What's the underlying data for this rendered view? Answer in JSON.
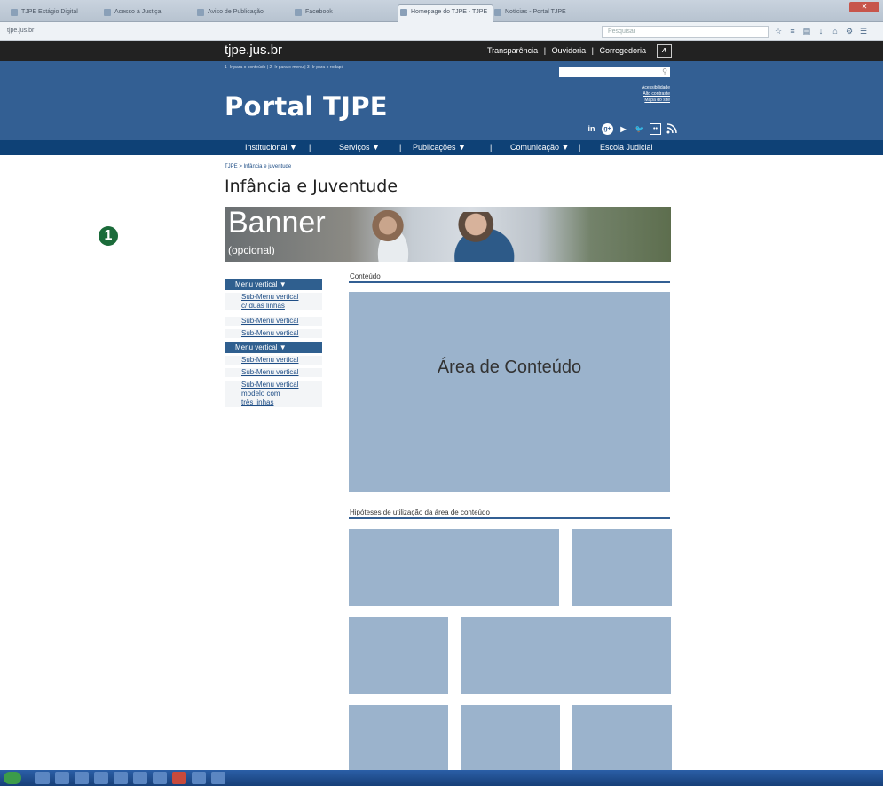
{
  "browser": {
    "tabs": [
      {
        "label": "TJPE Estágio Digital"
      },
      {
        "label": "Acesso à Justiça"
      },
      {
        "label": "Aviso de Publicação"
      },
      {
        "label": "Facebook"
      },
      {
        "label": "Homepage do TJPE - TJPE"
      },
      {
        "label": "Notícias - Portal TJPE"
      }
    ],
    "url": "tjpe.jus.br",
    "search_placeholder": "Pesquisar",
    "window_control": "✕"
  },
  "site": {
    "domain": "tjpe.jus.br",
    "top_links": [
      "Transparência",
      "Ouvidoria",
      "Corregedoria"
    ],
    "contrast_button": "A",
    "skip_links": "1- Ir para o conteúdo  |  2- Ir para o menu  |  3- Ir para o rodapé",
    "search_icon": "⚲",
    "access_links": [
      "Acessibilidade",
      "Alto contraste",
      "Mapa do site"
    ],
    "portal_title": "Portal TJPE",
    "social": [
      {
        "icon": "linkedin-icon",
        "glyph": "in"
      },
      {
        "icon": "google-plus-icon",
        "glyph": "g+"
      },
      {
        "icon": "youtube-icon",
        "glyph": "▶"
      },
      {
        "icon": "twitter-icon",
        "glyph": "🐦"
      },
      {
        "icon": "flickr-icon",
        "glyph": "••"
      },
      {
        "icon": "rss-icon",
        "glyph": "☰"
      }
    ],
    "nav": [
      {
        "label": "Institucional ▼"
      },
      {
        "label": "Serviços ▼"
      },
      {
        "label": "Publicações ▼"
      },
      {
        "label": "Comunicação ▼"
      },
      {
        "label": "Escola Judicial"
      }
    ],
    "nav_separator": "|"
  },
  "page": {
    "breadcrumb": "TJPE > Infância e juventude",
    "title": "Infância e Juventude",
    "banner": {
      "text": "Banner",
      "subtext": "(opcional)"
    },
    "annotation_badge": "1",
    "sidebar": {
      "groups": [
        {
          "head": "Menu vertical  ▼",
          "items": [
            {
              "lines": [
                "Sub-Menu vertical",
                "c/ duas linhas"
              ]
            },
            {
              "lines": [
                "Sub-Menu vertical"
              ]
            },
            {
              "lines": [
                "Sub-Menu vertical"
              ]
            }
          ]
        },
        {
          "head": "Menu vertical  ▼",
          "items": [
            {
              "lines": [
                "Sub-Menu vertical"
              ]
            },
            {
              "lines": [
                "Sub-Menu vertical"
              ]
            },
            {
              "lines": [
                "Sub-Menu vertical",
                "modelo com",
                "três linhas"
              ]
            }
          ]
        }
      ]
    },
    "content_label": "Conteúdo",
    "content_area_text": "Área de Conteúdo",
    "hypotheses_label": "Hipóteses de utilização da área de conteúdo"
  },
  "colors": {
    "header_blue": "#335f93",
    "nav_blue": "#0e4176",
    "block_blue": "#9bb3cc",
    "badge_green": "#1b6b3a"
  }
}
